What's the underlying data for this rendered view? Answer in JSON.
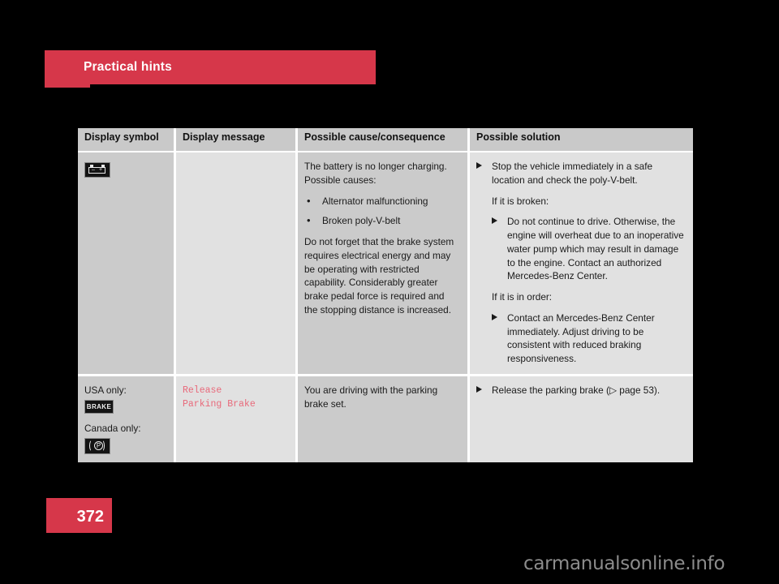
{
  "header": {
    "title": "Practical hints"
  },
  "table": {
    "columns": [
      "Display symbol",
      "Display message",
      "Possible cause/consequence",
      "Possible solution"
    ],
    "rows": [
      {
        "symbol": {
          "icon": "battery-icon",
          "battery_minus": "–",
          "battery_plus": "+"
        },
        "message": "",
        "cause": {
          "intro_line1": "The battery is no longer charging.",
          "intro_line2": "Possible causes:",
          "bullets": [
            "Alternator malfunctioning",
            "Broken poly-V-belt"
          ],
          "note": "Do not forget that the brake system requires electrical energy and may be operating with restricted capability. Considerably greater brake pedal force is required and the stopping distance is increased."
        },
        "solution": {
          "step1": "Stop the vehicle immediately in a safe location and check the poly-V-belt.",
          "cond1": "If it is broken:",
          "step2": "Do not continue to drive. Otherwise, the engine will overheat due to an inoperative water pump which may result in damage to the engine. Contact an authorized Mercedes-Benz Center.",
          "cond2": "If it is in order:",
          "step3": "Contact an Mercedes-Benz Center immediately. Adjust driving to be consistent with reduced braking responsiveness."
        }
      },
      {
        "symbol": {
          "usa_label": "USA only:",
          "usa_icon": "brake-warning-icon",
          "usa_icon_text": "BRAKE",
          "canada_label": "Canada only:",
          "canada_icon": "parking-brake-icon",
          "canada_icon_text": "P"
        },
        "message_line1": "Release",
        "message_line2": "Parking Brake",
        "cause": "You are driving with the parking brake set.",
        "solution": {
          "step1_pre": "Release the parking brake (",
          "step1_ref": "▷ page 53",
          "step1_post": ")."
        }
      }
    ]
  },
  "footer": {
    "page_number": "372"
  },
  "watermark": {
    "text": "carmanualsonline.info"
  },
  "colors": {
    "brand_red": "#d6374a",
    "message_red": "#e8697a",
    "cell_dark": "#cbcbcb",
    "cell_light": "#e1e1e1",
    "header_gray": "#c9c9c9",
    "page_bg": "#000000"
  }
}
